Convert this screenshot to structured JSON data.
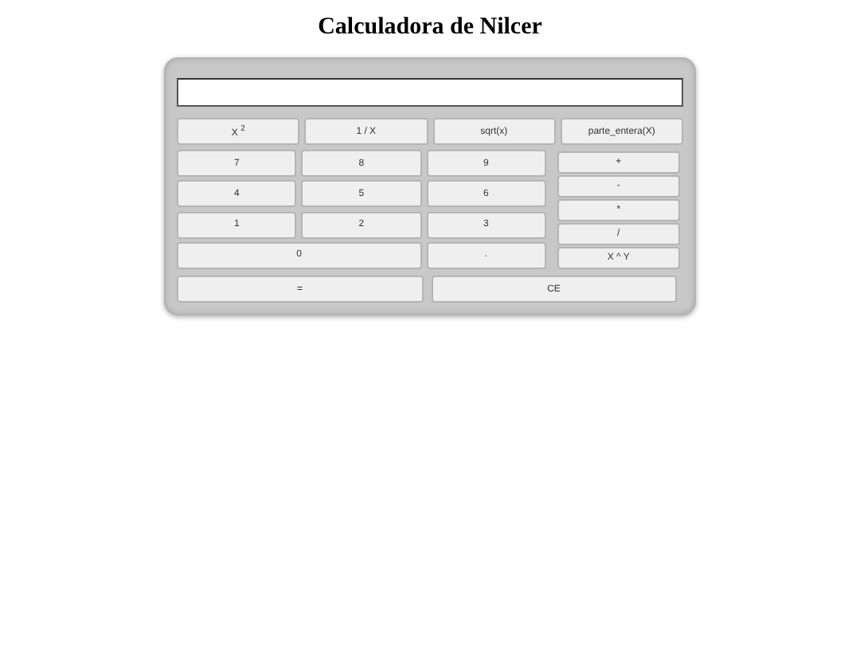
{
  "title": "Calculadora de Nilcer",
  "function_keys": [
    "X $^{2}$",
    "1 / X",
    "sqrt(x)",
    "parte_entera(X)"
  ],
  "digit_keys": [
    {
      "label": "7",
      "wide": false
    },
    {
      "label": "8",
      "wide": false
    },
    {
      "label": "9",
      "wide": false
    },
    {
      "label": "4",
      "wide": false
    },
    {
      "label": "5",
      "wide": false
    },
    {
      "label": "6",
      "wide": false
    },
    {
      "label": "1",
      "wide": false
    },
    {
      "label": "2",
      "wide": false
    },
    {
      "label": "3",
      "wide": false
    },
    {
      "label": "0",
      "wide": true
    },
    {
      "label": ".",
      "wide": false
    }
  ],
  "operator_keys": [
    "+",
    "-",
    "*",
    "/",
    "X ^ Y"
  ],
  "bottom_keys": [
    "=",
    "CE"
  ]
}
